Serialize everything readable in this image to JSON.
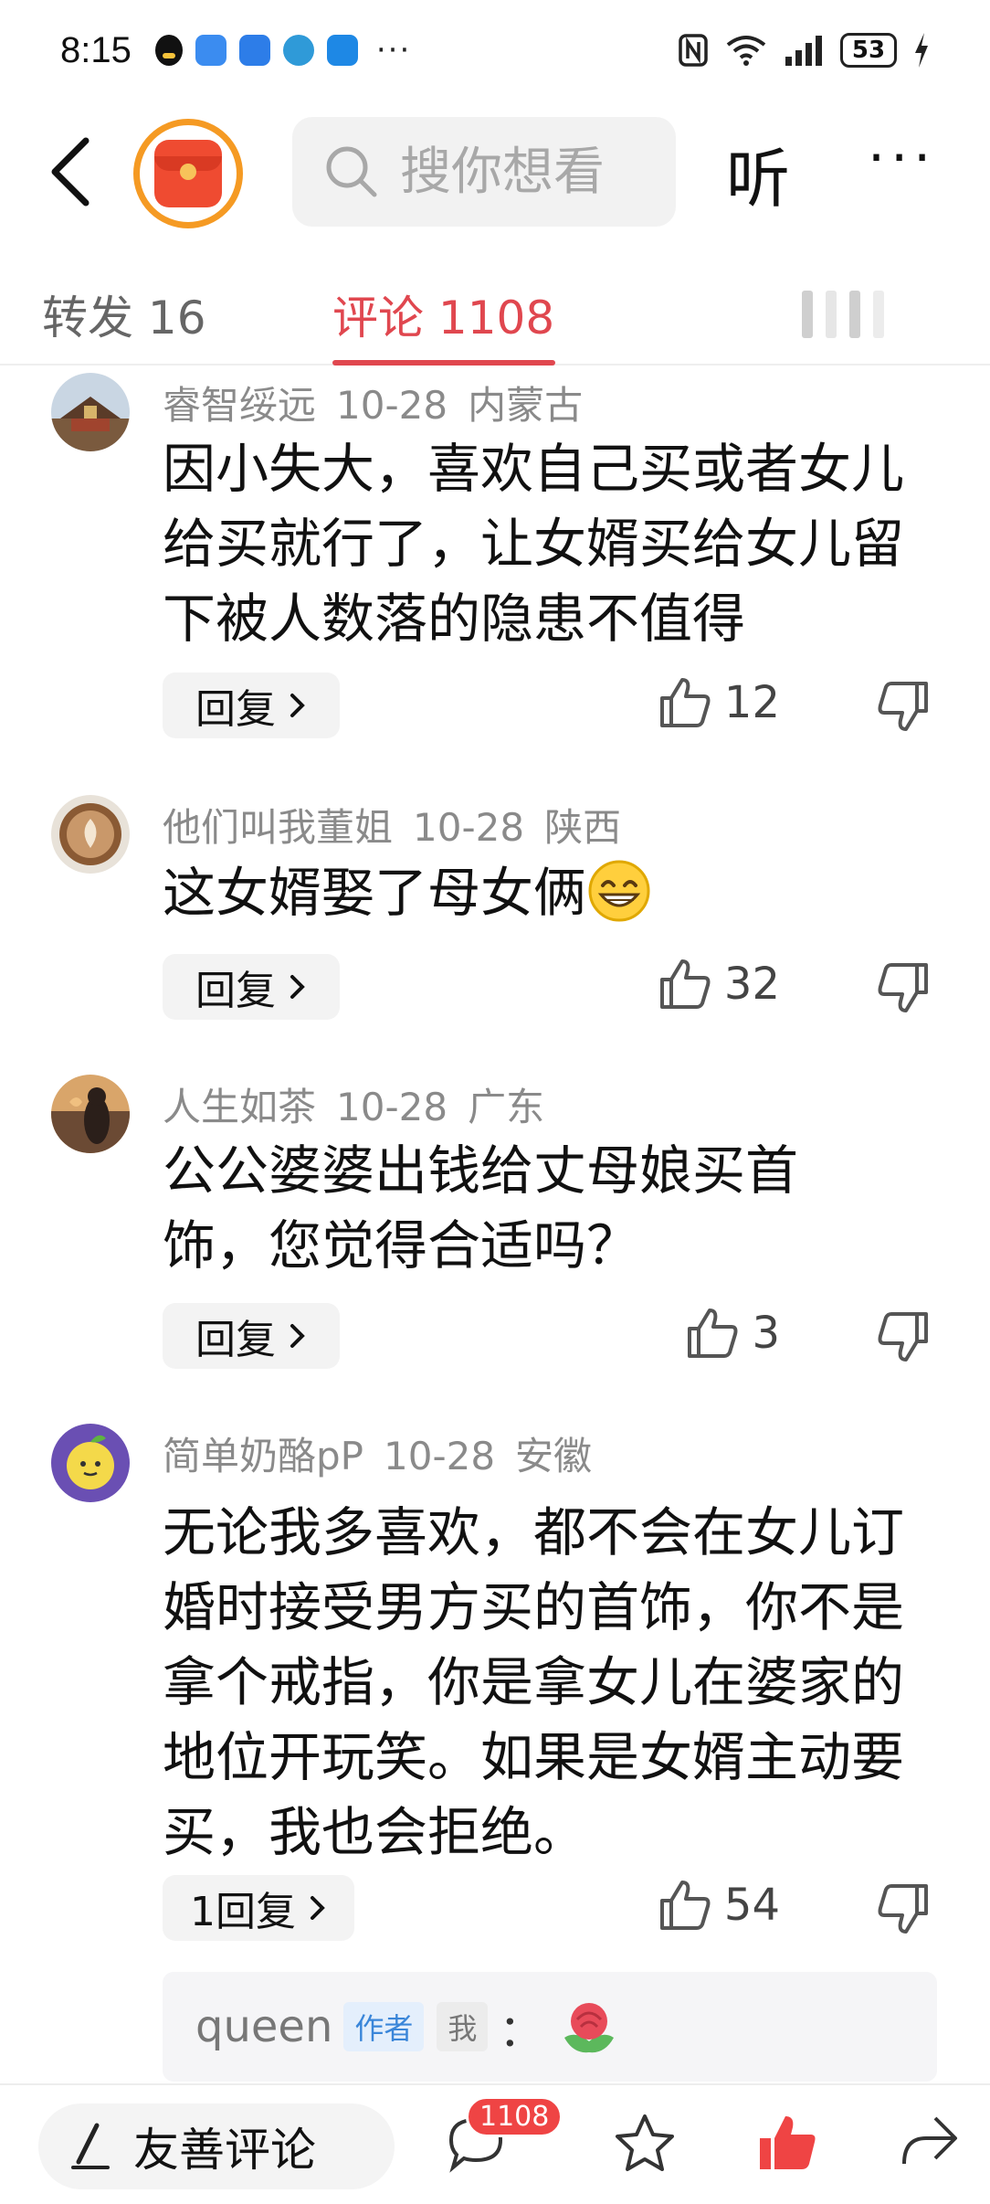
{
  "status_bar": {
    "time": "8:15",
    "more": "···",
    "battery": "53"
  },
  "header": {
    "search_placeholder": "搜你想看",
    "listen_label": "听",
    "more_label": "···"
  },
  "tabs": {
    "forward": "转发 16",
    "comment": "评论 1108"
  },
  "comments": [
    {
      "user": "睿智绥远",
      "date": "10-28",
      "region": "内蒙古",
      "text": "因小失大，喜欢自己买或者女儿给买就行了，让女婿买给女儿留下被人数落的隐患不值得",
      "reply": "回复",
      "likes": "12"
    },
    {
      "user": "他们叫我董姐",
      "date": "10-28",
      "region": "陕西",
      "text": "这女婿娶了母女俩",
      "reply": "回复",
      "likes": "32"
    },
    {
      "user": "人生如茶",
      "date": "10-28",
      "region": "广东",
      "text": "公公婆婆出钱给丈母娘买首饰，您觉得合适吗？",
      "reply": "回复",
      "likes": "3"
    },
    {
      "user": "简单奶酪pP",
      "date": "10-28",
      "region": "安徽",
      "text": "无论我多喜欢，都不会在女儿订婚时接受男方买的首饰，你不是拿个戒指，你是拿女儿在婆家的地位开玩笑。如果是女婿主动要买，我也会拒绝。",
      "reply": "1回复",
      "likes": "54"
    }
  ],
  "author_reply": {
    "name": "queen",
    "author_tag": "作者",
    "me_tag": "我",
    "colon": "："
  },
  "bottom_bar": {
    "friendly_comment": "友善评论",
    "comment_count": "1108"
  },
  "colors": {
    "accent": "#e0474f",
    "like_active": "#ef4444"
  }
}
